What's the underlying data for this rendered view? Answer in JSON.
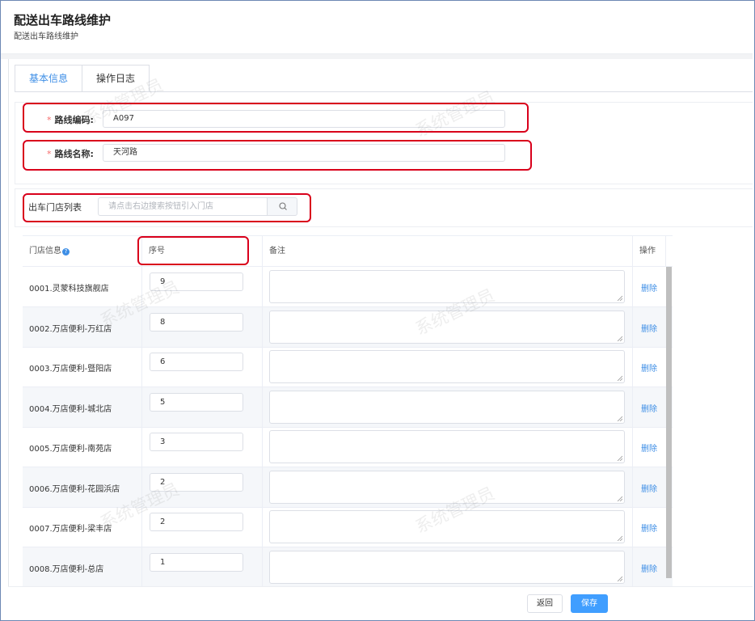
{
  "page": {
    "title": "配送出车路线维护",
    "subtitle": "配送出车路线维护"
  },
  "tabs": [
    {
      "label": "基本信息",
      "active": true
    },
    {
      "label": "操作日志",
      "active": false
    }
  ],
  "form": {
    "route_code": {
      "label": "路线编码:",
      "value": "A097",
      "required": "*"
    },
    "route_name": {
      "label": "路线名称:",
      "value": "天河路",
      "required": "*"
    }
  },
  "store_list": {
    "label": "出车门店列表",
    "search_placeholder": "请点击右边搜索按钮引入门店",
    "search_icon": "search-icon"
  },
  "table": {
    "headers": {
      "store": "门店信息",
      "seq": "序号",
      "remark": "备注",
      "action": "操作"
    },
    "help_glyph": "?",
    "delete_label": "删除",
    "rows": [
      {
        "store": "0001.灵蒙科技旗舰店",
        "seq": "9"
      },
      {
        "store": "0002.万店便利-万红店",
        "seq": "8"
      },
      {
        "store": "0003.万店便利-暨阳店",
        "seq": "6"
      },
      {
        "store": "0004.万店便利-城北店",
        "seq": "5"
      },
      {
        "store": "0005.万店便利-南苑店",
        "seq": "3"
      },
      {
        "store": "0006.万店便利-花园浜店",
        "seq": "2"
      },
      {
        "store": "0007.万店便利-梁丰店",
        "seq": "2"
      },
      {
        "store": "0008.万店便利-总店",
        "seq": "1"
      }
    ]
  },
  "footer": {
    "back_label": "返回",
    "save_label": "保存"
  },
  "watermark_text": "系统管理员",
  "colors": {
    "accent": "#409eff",
    "highlight": "#d9001b",
    "required": "#f56c6c",
    "link": "#3d8ee6"
  }
}
